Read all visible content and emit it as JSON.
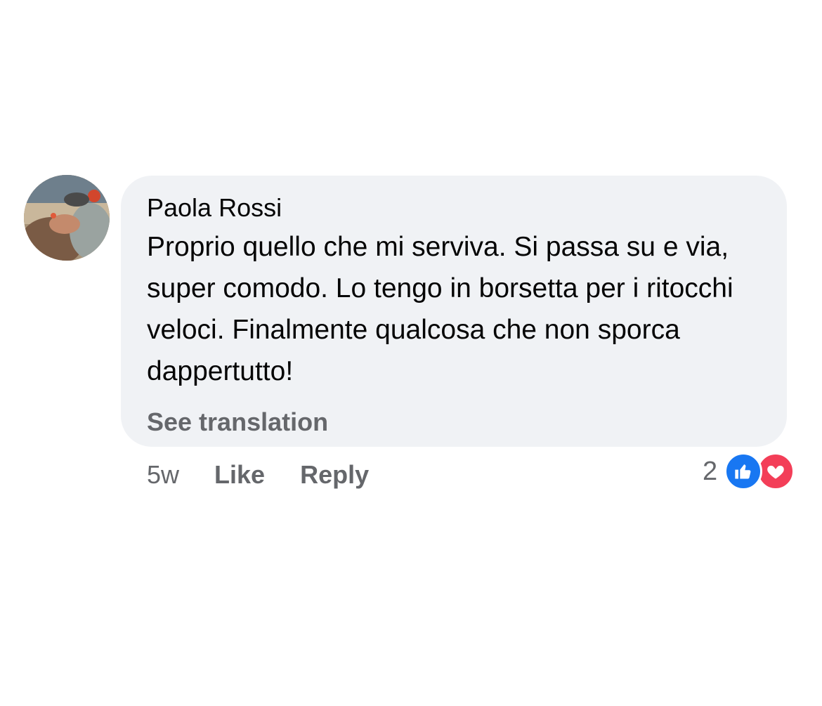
{
  "comment": {
    "author": "Paola Rossi",
    "text": "Proprio quello che mi serviva. Si passa su e via, super comodo. Lo tengo in borsetta per i ritocchi veloci. Finalmente qualcosa che non sporca dappertutto!",
    "see_translation_label": "See translation",
    "timestamp": "5w",
    "like_label": "Like",
    "reply_label": "Reply",
    "reaction_count": "2",
    "reactions": [
      "like-icon",
      "love-icon"
    ]
  },
  "colors": {
    "bubble_bg": "#f0f2f5",
    "secondary_text": "#65676b",
    "primary_text": "#050505",
    "like_blue": "#1877f2",
    "love_red": "#f33e58"
  }
}
